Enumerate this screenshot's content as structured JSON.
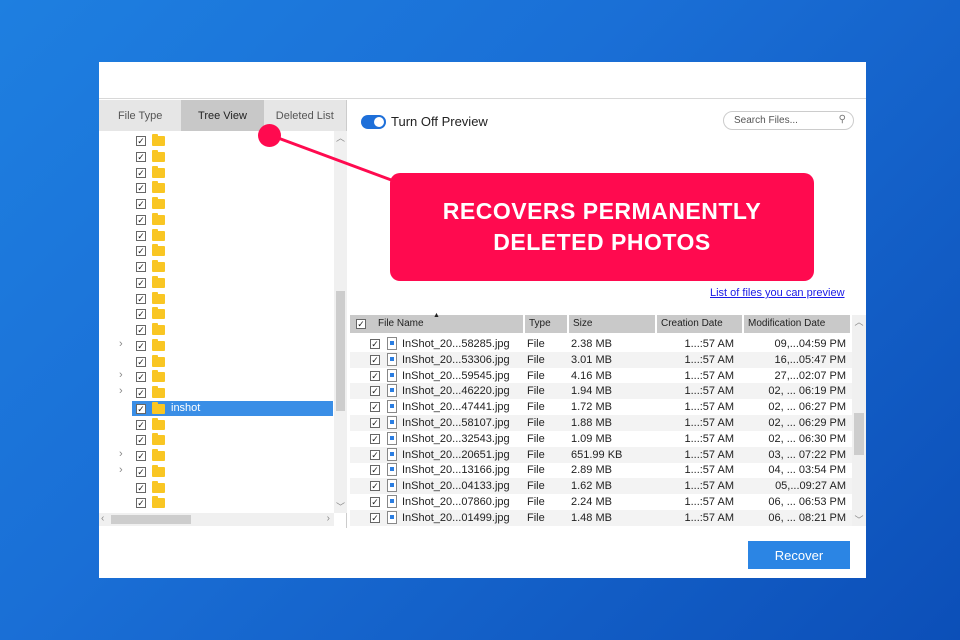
{
  "tabs": [
    "File Type",
    "Tree View",
    "Deleted List"
  ],
  "active_tab": 1,
  "tree": {
    "rows": 24,
    "expandable_rows": [
      13,
      15,
      16,
      20,
      21
    ],
    "selected_row": 17,
    "selected_label": "inshot"
  },
  "preview_toggle": {
    "label": "Turn Off Preview",
    "on": true
  },
  "search": {
    "placeholder": "Search Files..."
  },
  "preview_link": "List of files you can preview",
  "callout": {
    "line1": "RECOVERS PERMANENTLY",
    "line2": "DELETED PHOTOS"
  },
  "table": {
    "columns": [
      "File Name",
      "Type",
      "Size",
      "Creation Date",
      "Modification Date"
    ],
    "rows": [
      [
        "InShot_20...58285.jpg",
        "File",
        "2.38 MB",
        "1...:57 AM",
        "09,...04:59 PM"
      ],
      [
        "InShot_20...53306.jpg",
        "File",
        "3.01 MB",
        "1...:57 AM",
        "16,...05:47 PM"
      ],
      [
        "InShot_20...59545.jpg",
        "File",
        "4.16 MB",
        "1...:57 AM",
        "27,...02:07 PM"
      ],
      [
        "InShot_20...46220.jpg",
        "File",
        "1.94 MB",
        "1...:57 AM",
        "02, ... 06:19 PM"
      ],
      [
        "InShot_20...47441.jpg",
        "File",
        "1.72 MB",
        "1...:57 AM",
        "02, ... 06:27 PM"
      ],
      [
        "InShot_20...58107.jpg",
        "File",
        "1.88 MB",
        "1...:57 AM",
        "02, ... 06:29 PM"
      ],
      [
        "InShot_20...32543.jpg",
        "File",
        "1.09 MB",
        "1...:57 AM",
        "02, ... 06:30 PM"
      ],
      [
        "InShot_20...20651.jpg",
        "File",
        "651.99 KB",
        "1...:57 AM",
        "03, ... 07:22 PM"
      ],
      [
        "InShot_20...13166.jpg",
        "File",
        "2.89 MB",
        "1...:57 AM",
        "04, ... 03:54 PM"
      ],
      [
        "InShot_20...04133.jpg",
        "File",
        "1.62 MB",
        "1...:57 AM",
        "05,...09:27 AM"
      ],
      [
        "InShot_20...07860.jpg",
        "File",
        "2.24 MB",
        "1...:57 AM",
        "06, ... 06:53 PM"
      ],
      [
        "InShot_20...01499.jpg",
        "File",
        "1.48 MB",
        "1...:57 AM",
        "06, ... 08:21 PM"
      ]
    ]
  },
  "recover_label": "Recover"
}
